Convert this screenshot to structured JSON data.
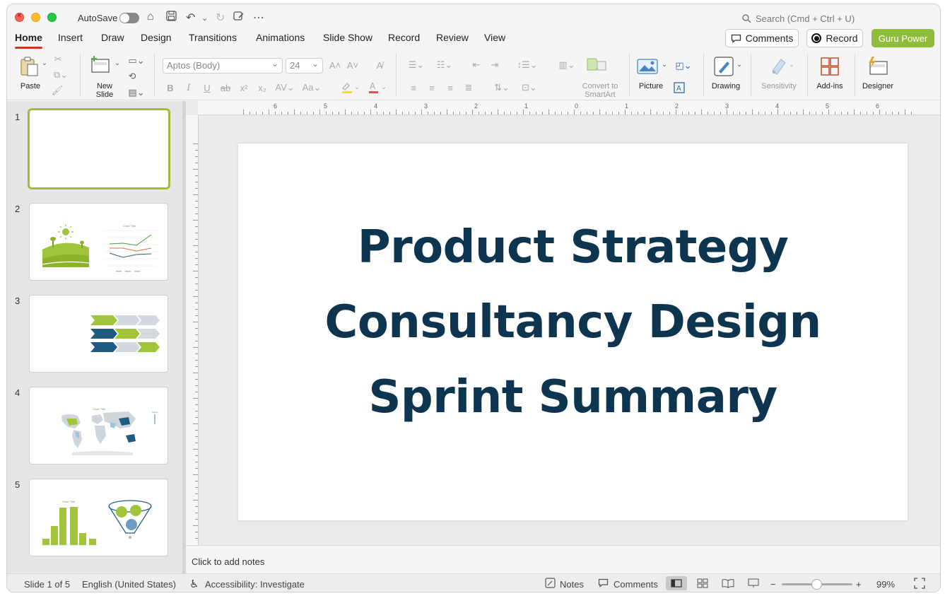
{
  "titlebar": {
    "autosave_label": "AutoSave",
    "search_placeholder": "Search (Cmd + Ctrl + U)"
  },
  "tabs": [
    "Home",
    "Insert",
    "Draw",
    "Design",
    "Transitions",
    "Animations",
    "Slide Show",
    "Record",
    "Review",
    "View"
  ],
  "active_tab": "Home",
  "header_buttons": {
    "comments": "Comments",
    "record": "Record",
    "guru": "Guru Power"
  },
  "ribbon": {
    "paste": "Paste",
    "new_slide_1": "New",
    "new_slide_2": "Slide",
    "font_name": "Aptos (Body)",
    "font_size": "24",
    "convert_1": "Convert to",
    "convert_2": "SmartArt",
    "picture": "Picture",
    "drawing": "Drawing",
    "sensitivity": "Sensitivity",
    "addins": "Add-ins",
    "designer": "Designer"
  },
  "slides": [
    {
      "num": "1"
    },
    {
      "num": "2"
    },
    {
      "num": "3"
    },
    {
      "num": "4"
    },
    {
      "num": "5"
    }
  ],
  "ruler_h": [
    "6",
    "5",
    "4",
    "3",
    "2",
    "1",
    "0",
    "1",
    "2",
    "3",
    "4",
    "5",
    "6"
  ],
  "slide_content": {
    "line1": "Product Strategy",
    "line2": "Consultancy Design",
    "line3": "Sprint Summary"
  },
  "notes_placeholder": "Click to add notes",
  "statusbar": {
    "slide_counter": "Slide 1 of 5",
    "language": "English (United States)",
    "accessibility": "Accessibility: Investigate",
    "notes": "Notes",
    "comments": "Comments",
    "zoom": "99%"
  },
  "colors": {
    "accent_tab": "#c43e1c",
    "guru_green": "#8fbc3a",
    "title_navy": "#0d3550",
    "thumb_green": "#a2c43a",
    "thumb_blue": "#1f5a80"
  }
}
